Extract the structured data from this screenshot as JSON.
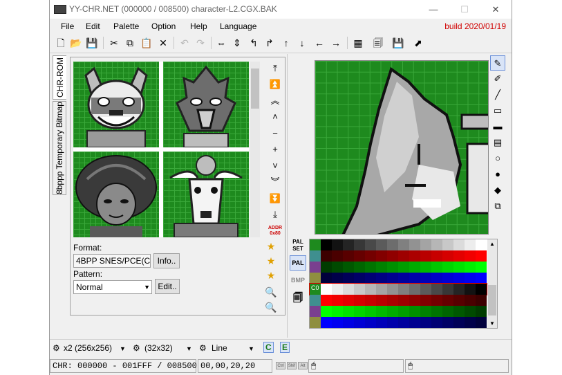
{
  "window": {
    "title": "YY-CHR.NET (000000 / 008500) character-L2.CGX.BAK",
    "minimize": "—",
    "maximize": "☐",
    "close": "✕"
  },
  "menu": {
    "items": [
      "File",
      "Edit",
      "Palette",
      "Option",
      "Help",
      "Language"
    ],
    "build": "build 2020/01/19"
  },
  "tabs": [
    "CHR-ROM",
    "8bppp Temporary Bitmap"
  ],
  "format": {
    "label": "Format:",
    "value": "4BPP SNES/PCE(C",
    "info_button": "Info.."
  },
  "pattern": {
    "label": "Pattern:",
    "value": "Normal",
    "edit_button": "Edit.."
  },
  "addr_label": [
    "ADDR",
    "0x80"
  ],
  "pal_buttons": [
    "PAL SET",
    "PAL",
    "BMP"
  ],
  "palette_row_label": "C0",
  "colors": {
    "tile_bg": "#1e8a1e",
    "grid_line": "#3aa83a",
    "build_text": "#d00000"
  },
  "bottom": {
    "zoom": "x2 (256x256)",
    "tile_size": "(32x32)",
    "tool": "Line"
  },
  "status": {
    "chr": "CHR: 000000 - 001FFF / 008500",
    "coords": "00,00,20,20",
    "keys": [
      "Ctrl",
      "Shif",
      "Alt"
    ]
  }
}
